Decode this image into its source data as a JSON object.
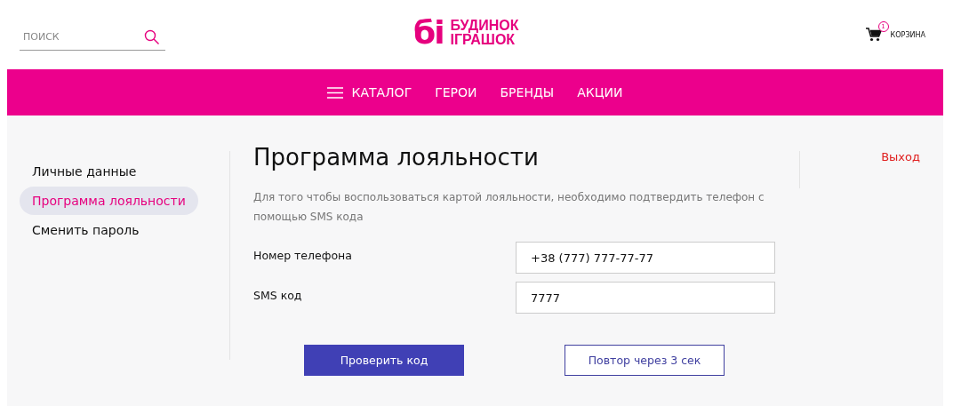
{
  "header": {
    "search": {
      "placeholder": "ПОИСК"
    },
    "logo": {
      "mark": "бі",
      "line_1": "БУДИНОК",
      "line_2": "ІГРАШОК"
    },
    "cart": {
      "count": "1",
      "label": "КОРЗИНА"
    }
  },
  "nav": {
    "items": [
      {
        "label": "КАТАЛОГ",
        "kind": "menu"
      },
      {
        "label": "ГЕРОИ",
        "kind": "link"
      },
      {
        "label": "БРЕНДЫ",
        "kind": "link"
      },
      {
        "label": "АКЦИИ",
        "kind": "link"
      }
    ]
  },
  "sidebar": {
    "items": [
      {
        "label": "Личные данные",
        "selected": false
      },
      {
        "label": "Программа лояльности",
        "selected": true
      },
      {
        "label": "Сменить пароль",
        "selected": false
      }
    ]
  },
  "main": {
    "title": "Программа лояльности",
    "description": "Для того чтобы воспользоваться картой лояльности, необходимо подтвердить телефон с помощью SMS кода",
    "fields": [
      {
        "label": "Номер телефона",
        "value": "+38 (777) 777-77-77"
      },
      {
        "label": "SMS код",
        "value": "7777"
      }
    ],
    "buttons": [
      {
        "label": "Проверить код",
        "kind": "primary"
      },
      {
        "label": "Повтор через 3 сек",
        "kind": "outline"
      }
    ]
  },
  "logout": "Выход"
}
